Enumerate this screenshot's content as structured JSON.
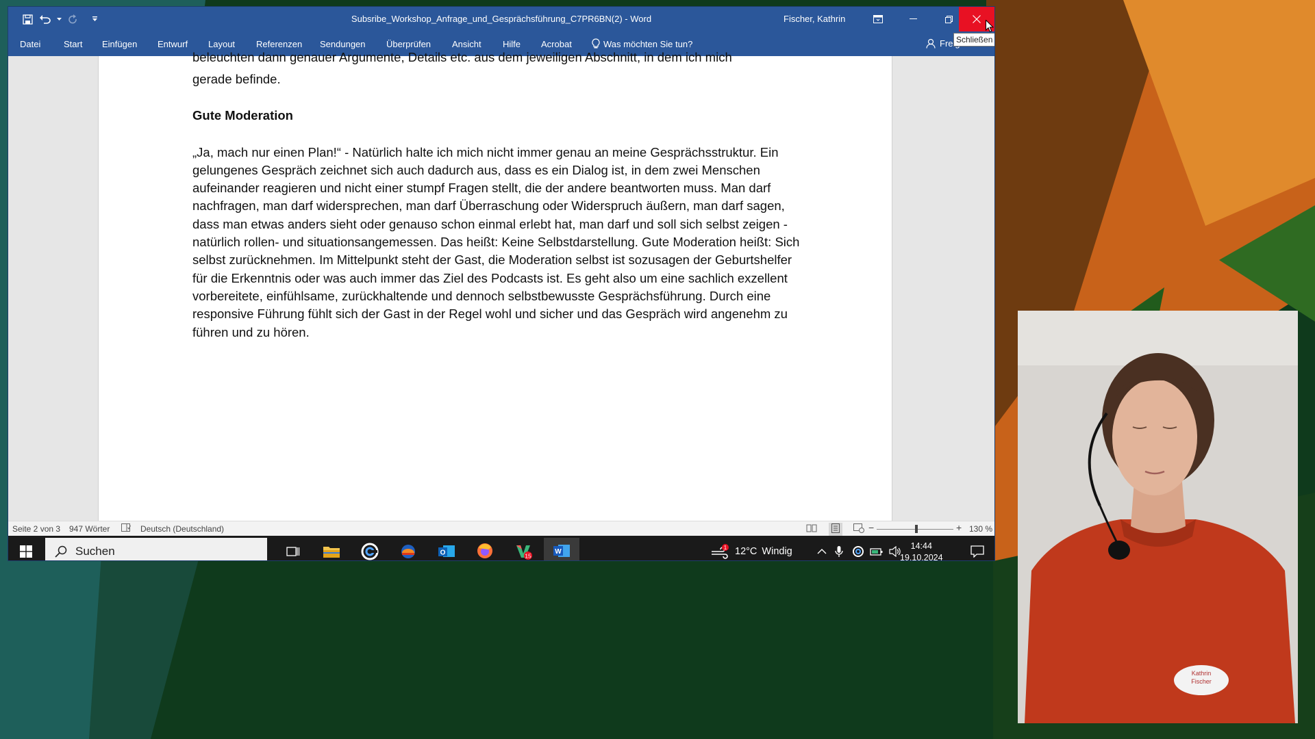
{
  "window": {
    "doc_title": "Subsribe_Workshop_Anfrage_und_Gesprächsführung_C7PR6BN(2)  -  Word",
    "user": "Fischer, Kathrin",
    "close_tooltip": "Schließen"
  },
  "ribbon": {
    "tabs": [
      "Datei",
      "Start",
      "Einfügen",
      "Entwurf",
      "Layout",
      "Referenzen",
      "Sendungen",
      "Überprüfen",
      "Ansicht",
      "Hilfe",
      "Acrobat"
    ],
    "tell_me": "Was möchten Sie tun?",
    "share": "Freigeben"
  },
  "document": {
    "cut_line": "beleuchten dann genauer Argumente, Details etc. aus dem jeweiligen Abschnitt, in dem ich mich",
    "line_end": "gerade befinde.",
    "heading": "Gute Moderation",
    "paragraph": "„Ja, mach nur einen Plan!“ - Natürlich halte ich mich nicht immer genau an meine Gesprächsstruktur. Ein gelungenes Gespräch zeichnet sich auch dadurch aus, dass es ein Dialog ist, in dem zwei Menschen aufeinander reagieren und nicht einer stumpf Fragen stellt, die der andere beantworten muss. Man darf nachfragen, man darf widersprechen, man darf Überraschung oder Widerspruch äußern, man darf sagen, dass man etwas anders sieht oder genauso schon einmal erlebt hat, man darf und soll sich selbst zeigen - natürlich rollen- und situationsangemessen.  Das heißt: Keine Selbstdarstellung. Gute Moderation heißt: Sich selbst zurücknehmen. Im Mittelpunkt steht der Gast, die Moderation selbst ist sozusagen der Geburtshelfer für die Erkenntnis oder was auch immer das Ziel des Podcasts ist. Es geht also um eine sachlich exzellent vorbereitete, einfühlsame, zurückhaltende und dennoch selbstbewusste Gesprächsführung. Durch eine responsive Führung fühlt sich der Gast in der Regel wohl und sicher und das Gespräch wird angenehm zu führen und zu hören."
  },
  "statusbar": {
    "page": "Seite 2 von 3",
    "words": "947 Wörter",
    "language": "Deutsch (Deutschland)",
    "zoom": "130 %",
    "zoom_level": 130
  },
  "taskbar": {
    "search": "Suchen",
    "weather_temp": "12°C",
    "weather_text": "Windig",
    "weather_badge": "1",
    "app_badge": "15",
    "time": "14:44",
    "date": "19.10.2024"
  },
  "webcam": {
    "name_tag_line1": "Kathrin",
    "name_tag_line2": "Fischer"
  },
  "colors": {
    "word_blue": "#2b579a",
    "close_red": "#e81123",
    "background_green": "#0f3a1c",
    "background_orange": "#c8621a",
    "background_teal": "#1e5f5a"
  }
}
